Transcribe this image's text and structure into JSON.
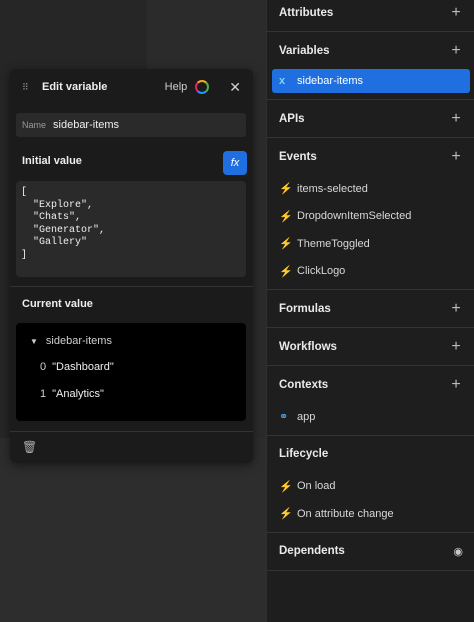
{
  "right_panel": {
    "attributes": {
      "title": "Attributes"
    },
    "variables": {
      "title": "Variables",
      "items": [
        {
          "label": "sidebar-items",
          "icon": "x-variable-icon"
        }
      ]
    },
    "apis": {
      "title": "APIs"
    },
    "events": {
      "title": "Events",
      "items": [
        {
          "label": "items-selected"
        },
        {
          "label": "DropdownItemSelected"
        },
        {
          "label": "ThemeToggled"
        },
        {
          "label": "ClickLogo"
        }
      ]
    },
    "formulas": {
      "title": "Formulas"
    },
    "workflows": {
      "title": "Workflows"
    },
    "contexts": {
      "title": "Contexts",
      "items": [
        {
          "label": "app"
        }
      ]
    },
    "lifecycle": {
      "title": "Lifecycle",
      "items": [
        {
          "label": "On load"
        },
        {
          "label": "On attribute change"
        }
      ]
    },
    "dependents": {
      "title": "Dependents"
    }
  },
  "modal": {
    "title": "Edit variable",
    "help": "Help",
    "name_label": "Name",
    "name_value": "sidebar-items",
    "initial_value_label": "Initial value",
    "fx_label": "fx",
    "initial_value_code": "[\n  \"Explore\",\n  \"Chats\",\n  \"Generator\",\n  \"Gallery\"\n]",
    "current_value_label": "Current value",
    "current_value": {
      "root": "sidebar-items",
      "items": [
        {
          "index": "0",
          "value": "\"Dashboard\""
        },
        {
          "index": "1",
          "value": "\"Analytics\""
        }
      ]
    }
  },
  "colors": {
    "accent": "#1f6fe0",
    "event_bolt": "#f2b632"
  }
}
